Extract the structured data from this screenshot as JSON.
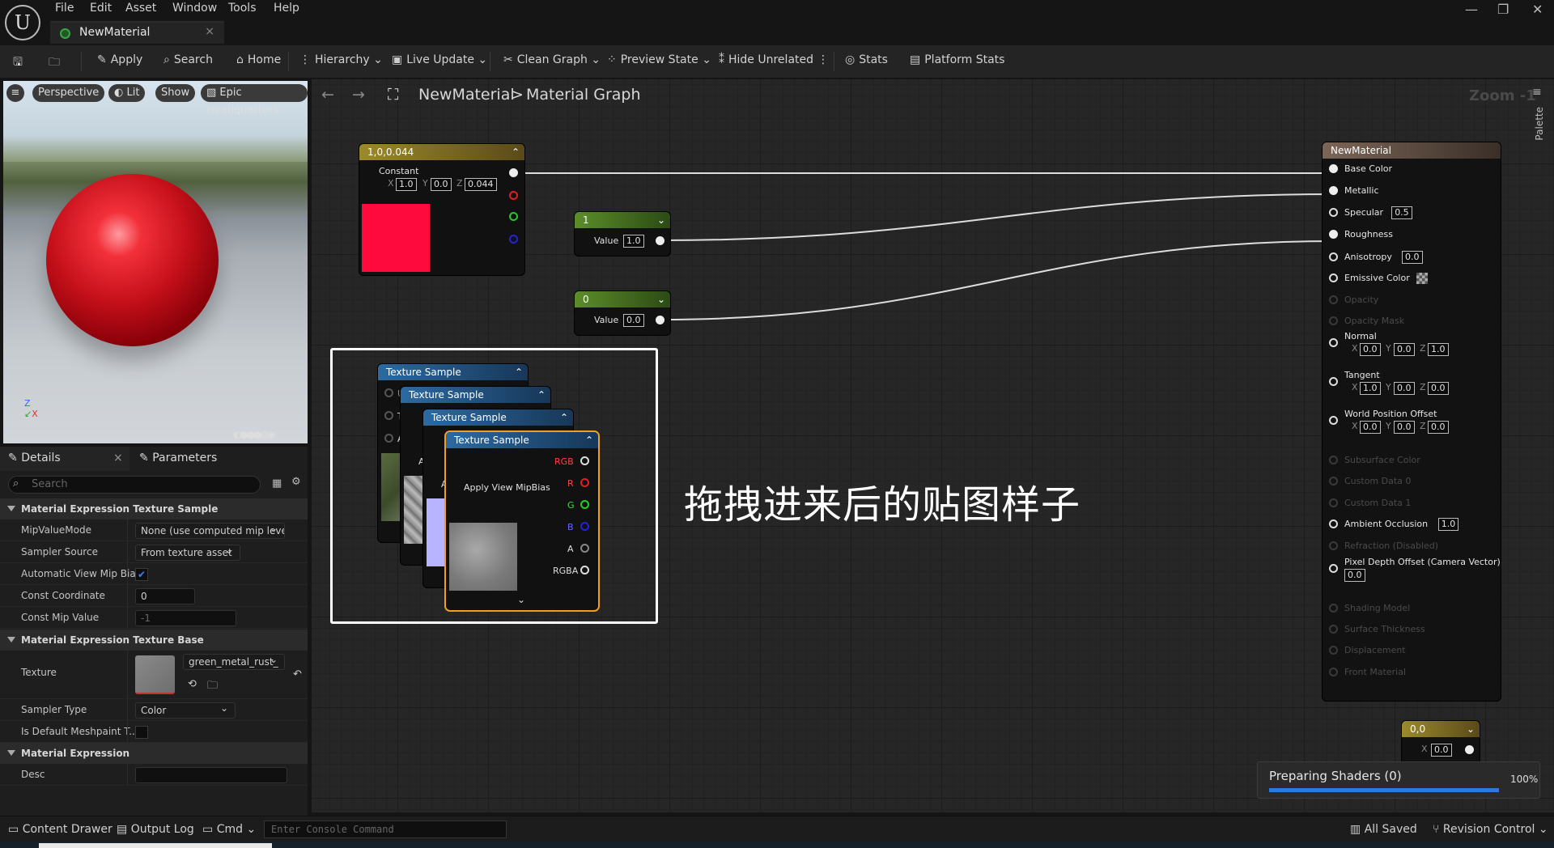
{
  "menu": [
    "File",
    "Edit",
    "Asset",
    "Window",
    "Tools",
    "Help"
  ],
  "tab": {
    "title": "NewMaterial",
    "close": "×"
  },
  "window_controls": [
    "—",
    "❐",
    "✕"
  ],
  "toolbar": {
    "apply": "Apply",
    "search": "Search",
    "home": "Home",
    "hierarchy": "Hierarchy",
    "live_update": "Live Update",
    "clean_graph": "Clean Graph",
    "preview_state": "Preview State",
    "hide_unrelated": "Hide Unrelated",
    "stats": "Stats",
    "platform_stats": "Platform Stats"
  },
  "viewport": {
    "perspective": "Perspective",
    "lit": "Lit",
    "show": "Show",
    "epic": "Epic Headquarters"
  },
  "details": {
    "tab_details": "Details",
    "tab_parameters": "Parameters",
    "search_placeholder": "Search",
    "section1": "Material Expression Texture Sample",
    "mip_value_mode_label": "MipValueMode",
    "mip_value_mode": "None (use computed mip level",
    "sampler_source_label": "Sampler Source",
    "sampler_source": "From texture asset",
    "auto_mip_label": "Automatic View Mip Bias",
    "const_coord_label": "Const Coordinate",
    "const_coord": "0",
    "const_mip_label": "Const Mip Value",
    "const_mip": "-1",
    "section2": "Material Expression Texture Base",
    "texture_label": "Texture",
    "texture": "green_metal_rust_",
    "sampler_type_label": "Sampler Type",
    "sampler_type": "Color",
    "default_meshpaint_label": "Is Default Meshpaint T...",
    "section3": "Material Expression",
    "desc_label": "Desc"
  },
  "graph": {
    "breadcrumb_root": "NewMaterial",
    "breadcrumb_sep": ">",
    "breadcrumb_leaf": "Material Graph",
    "zoom": "Zoom -1",
    "palette": "Palette",
    "constant_node": {
      "title": "1,0,0.044",
      "label": "Constant",
      "x": "1.0",
      "y": "0.0",
      "z": "0.044",
      "color": "#ff0a3c"
    },
    "scalar1": {
      "title": "1",
      "label": "Value",
      "value": "1.0"
    },
    "scalar0": {
      "title": "0",
      "label": "Value",
      "value": "0.0"
    },
    "texture_title": "Texture Sample",
    "annotation": "拖拽进来后的贴图样子",
    "material_node": {
      "title": "NewMaterial",
      "pins": [
        {
          "label": "Base Color",
          "active": true,
          "filled": true
        },
        {
          "label": "Metallic",
          "active": true,
          "filled": true
        },
        {
          "label": "Specular",
          "active": true,
          "value": "0.5"
        },
        {
          "label": "Roughness",
          "active": true,
          "filled": true
        },
        {
          "label": "Anisotropy",
          "active": true,
          "value": "0.0"
        },
        {
          "label": "Emissive Color",
          "active": true,
          "swatch": true
        },
        {
          "label": "Opacity",
          "active": false
        },
        {
          "label": "Opacity Mask",
          "active": false
        },
        {
          "label": "Normal",
          "active": true,
          "xyz": [
            "0.0",
            "0.0",
            "1.0"
          ]
        },
        {
          "label": "Tangent",
          "active": true,
          "xyz": [
            "1.0",
            "0.0",
            "0.0"
          ]
        },
        {
          "label": "World Position Offset",
          "active": true,
          "xyz": [
            "0.0",
            "0.0",
            "0.0"
          ]
        },
        {
          "label": "Subsurface Color",
          "active": false
        },
        {
          "label": "Custom Data 0",
          "active": false
        },
        {
          "label": "Custom Data 1",
          "active": false
        },
        {
          "label": "Ambient Occlusion",
          "active": true,
          "value": "1.0"
        },
        {
          "label": "Refraction (Disabled)",
          "active": false
        },
        {
          "label": "Pixel Depth Offset (Camera Vector)",
          "active": true,
          "value2": "0.0"
        },
        {
          "label": "Shading Model",
          "active": false
        },
        {
          "label": "Surface Thickness",
          "active": false
        },
        {
          "label": "Displacement",
          "active": false
        },
        {
          "label": "Front Material",
          "active": false
        }
      ]
    },
    "uv_node": {
      "title": "0,0",
      "x": "0.0"
    },
    "shaders": {
      "label": "Preparing Shaders (0)",
      "percent": "100%",
      "progress": 1.0
    }
  },
  "statusbar": {
    "content_drawer": "Content Drawer",
    "output_log": "Output Log",
    "cmd": "Cmd",
    "console_placeholder": "Enter Console Command",
    "all_saved": "All Saved",
    "revision_control": "Revision Control"
  }
}
